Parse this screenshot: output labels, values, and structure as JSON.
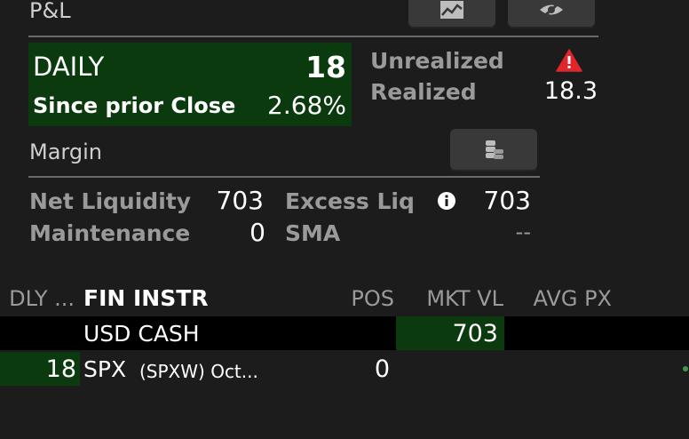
{
  "pnl": {
    "title": "P&L",
    "chart_button_icon": "chart-icon",
    "hide_button_icon": "eye-slash-icon",
    "daily_label": "DAILY",
    "daily_value": "18",
    "since_label": "Since prior Close",
    "since_value": "2.68%",
    "unrealized_label": "Unrealized",
    "unrealized_icon": "warning-icon",
    "realized_label": "Realized",
    "realized_value": "18.3"
  },
  "margin": {
    "title": "Margin",
    "coins_button_icon": "coins-icon",
    "net_liq_label": "Net Liquidity",
    "net_liq_value": "703",
    "excess_label": "Excess Liq",
    "excess_icon": "info-icon",
    "excess_value": "703",
    "maint_label": "Maintenance",
    "maint_value": "0",
    "sma_label": "SMA",
    "sma_value": "--"
  },
  "table": {
    "headers": [
      "DLY ...",
      "FIN INSTR",
      "POS",
      "MKT VL",
      "AVG PX"
    ],
    "rows": [
      {
        "dly": "",
        "instr_main": "USD CASH",
        "instr_sub": "",
        "pos": "",
        "mkt_vl": "703",
        "avg_px": ""
      },
      {
        "dly": "18",
        "instr_main": "SPX",
        "instr_sub": "(SPXW) Oct...",
        "pos": "0",
        "mkt_vl": "",
        "avg_px": ""
      }
    ]
  },
  "colors": {
    "background": "#1c1c1c",
    "positive_green": "#0b3a0f",
    "warning_red": "#e0262b",
    "muted_text": "#9a9a9a"
  }
}
